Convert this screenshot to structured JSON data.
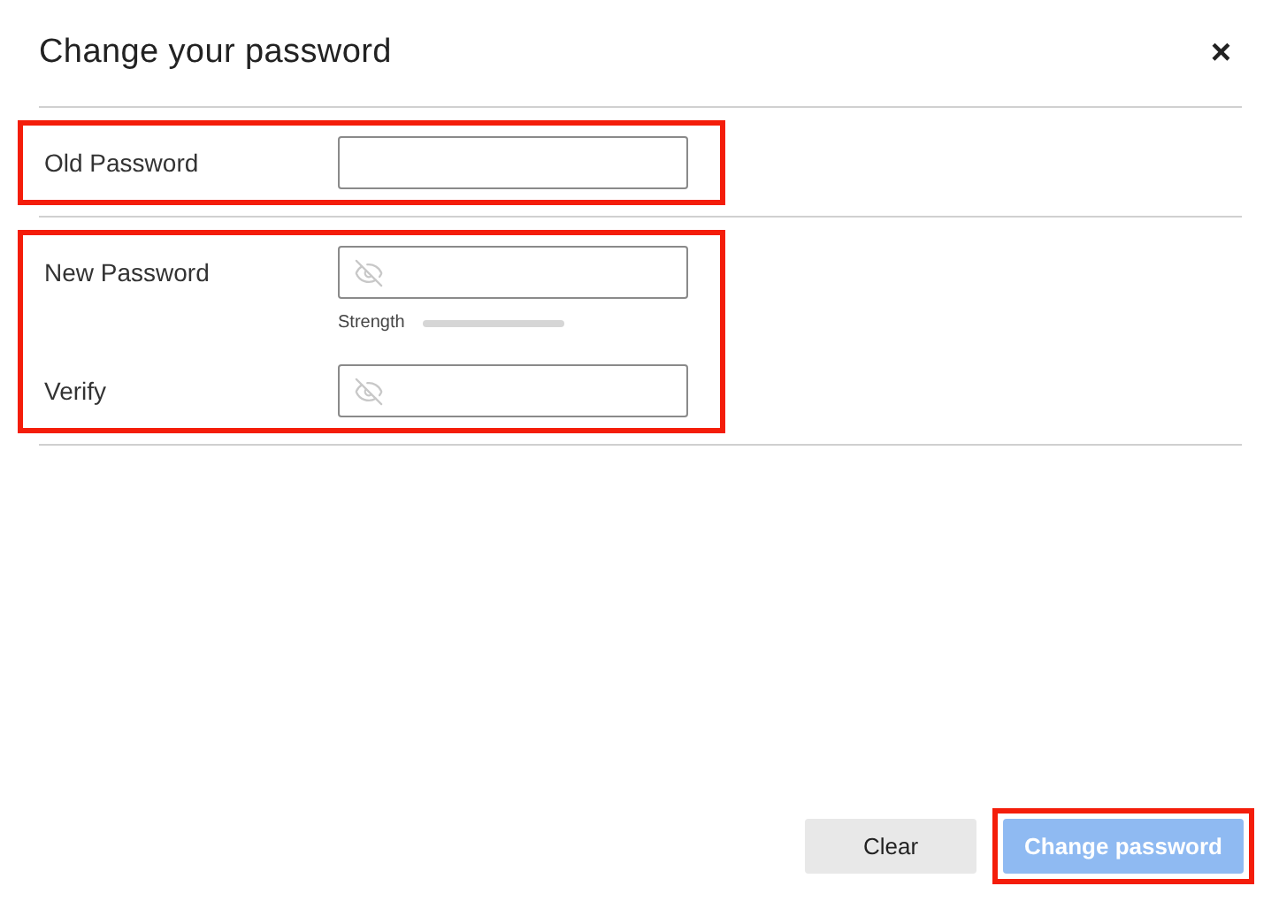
{
  "dialog": {
    "title": "Change your password",
    "close": "×"
  },
  "sections": [
    {
      "highlighted": true,
      "fields": [
        {
          "label": "Old Password",
          "kind": "plain"
        }
      ]
    },
    {
      "highlighted": true,
      "fields": [
        {
          "label": "New Password",
          "kind": "reveal",
          "strength": {
            "label": "Strength",
            "level": 0
          }
        },
        {
          "label": "Verify",
          "kind": "reveal"
        }
      ]
    }
  ],
  "buttons": [
    {
      "label": "Clear",
      "kind": "secondary",
      "disabled": false,
      "highlighted": false
    },
    {
      "label": "Change password",
      "kind": "primary",
      "disabled": true,
      "highlighted": true
    }
  ]
}
